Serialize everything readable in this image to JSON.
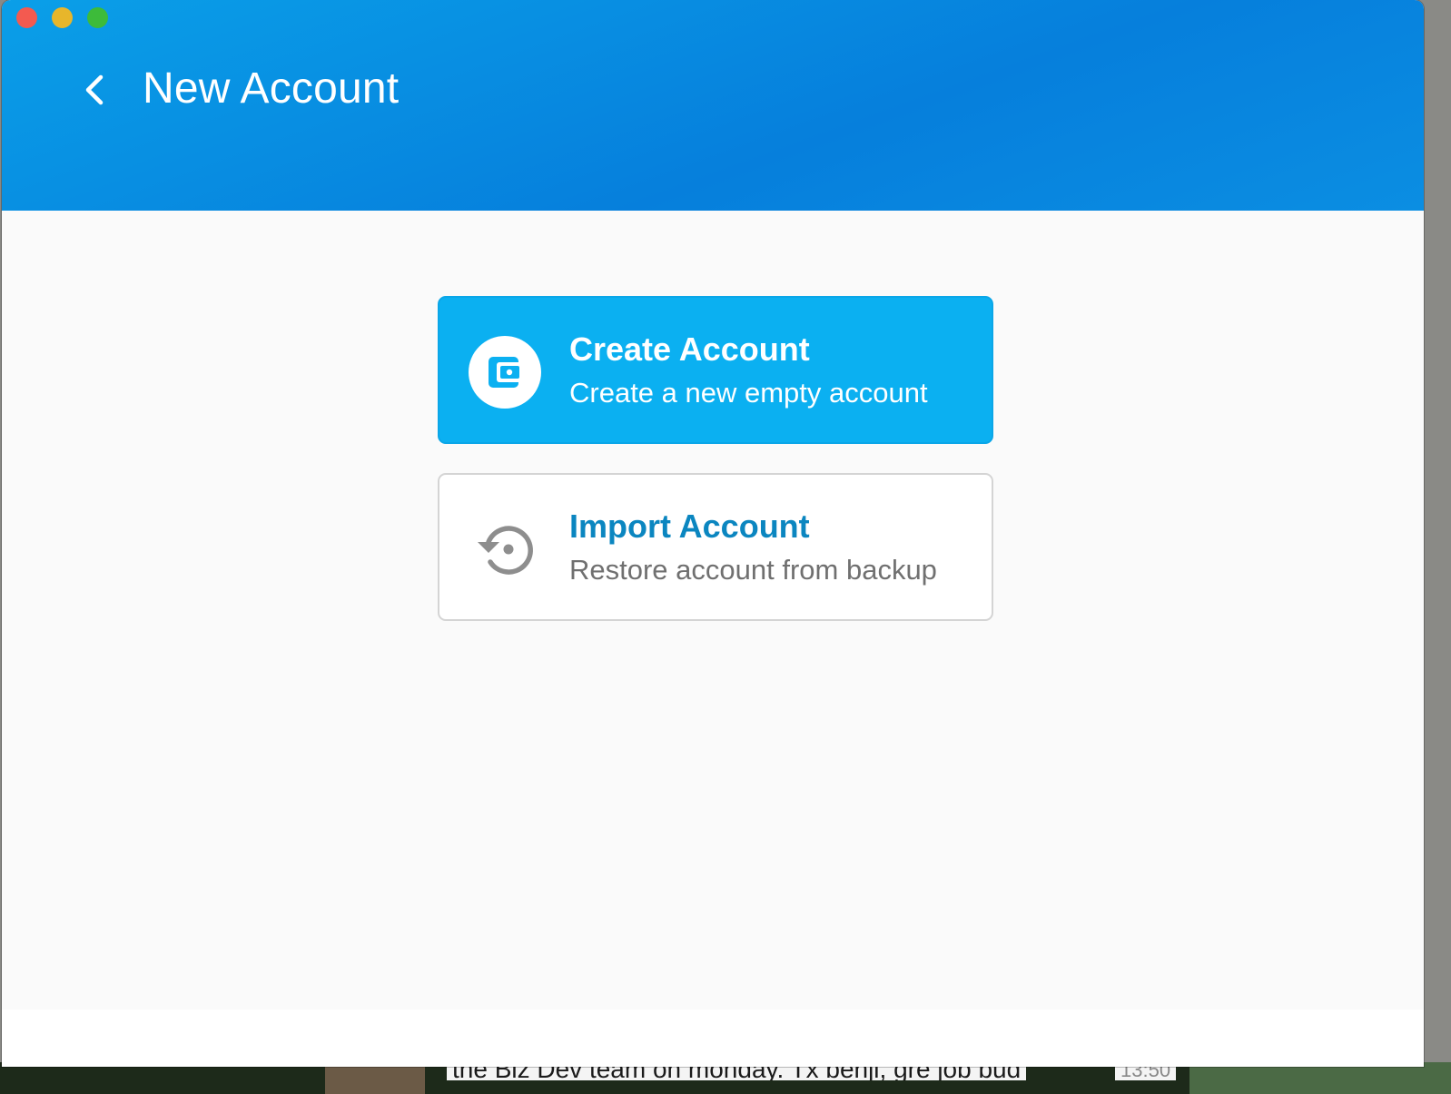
{
  "window": {
    "controls": [
      "close",
      "minimize",
      "maximize"
    ]
  },
  "header": {
    "back_icon": "chevron-left-icon",
    "title": "New Account"
  },
  "options": [
    {
      "id": "create",
      "icon": "wallet-icon",
      "title": "Create Account",
      "subtitle": "Create a new empty account",
      "selected": true
    },
    {
      "id": "import",
      "icon": "restore-icon",
      "title": "Import Account",
      "subtitle": "Restore account from backup",
      "selected": false
    }
  ],
  "colors": {
    "header_start": "#0a9fe8",
    "header_end": "#067fdc",
    "create_card": "#0bb0f1",
    "import_title": "#0b86c0",
    "import_subtitle": "#707070",
    "icon_gray": "#8e8e8e"
  },
  "background_peek": {
    "message_fragment": "the Biz Dev team on monday. Tx benji, gre job bud",
    "time_fragment": "13:50"
  }
}
